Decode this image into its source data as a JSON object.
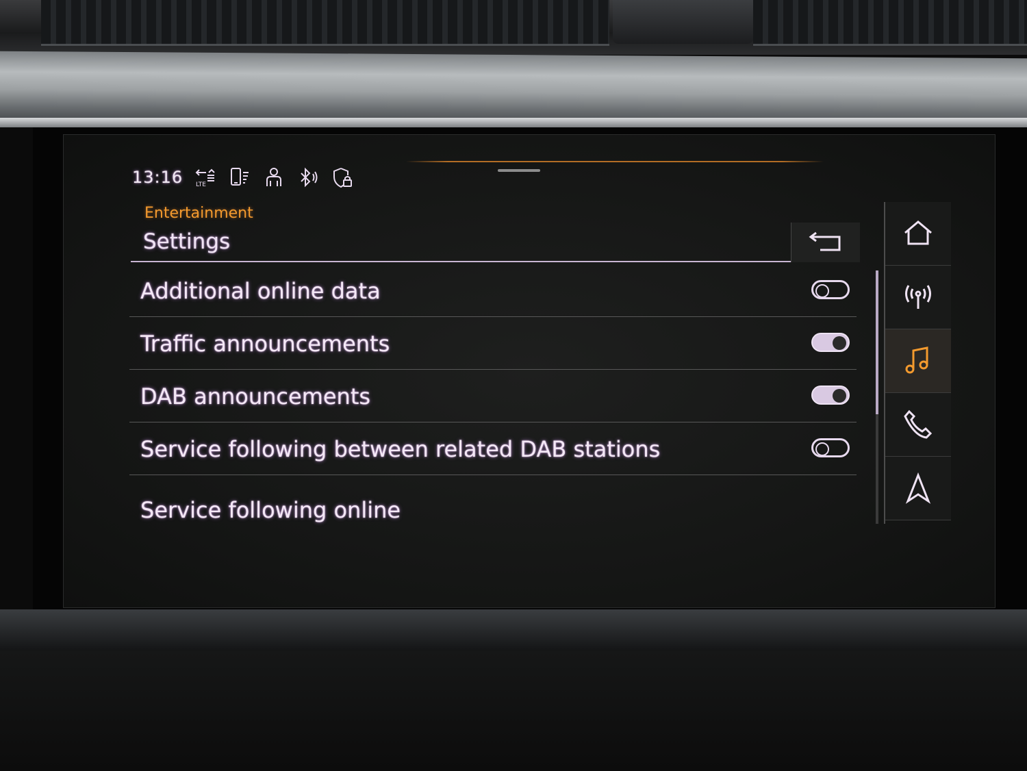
{
  "status_bar": {
    "time": "13:16",
    "icons": [
      "lte-signal-icon",
      "phone-data-icon",
      "user-profile-icon",
      "bluetooth-icon",
      "privacy-shield-icon"
    ]
  },
  "header": {
    "breadcrumb": "Entertainment",
    "title": "Settings",
    "back_icon": "back-arrow-icon"
  },
  "settings": {
    "items": [
      {
        "label": "Additional online data",
        "toggle": "off"
      },
      {
        "label": "Traffic announcements",
        "toggle": "on"
      },
      {
        "label": "DAB announcements",
        "toggle": "on"
      },
      {
        "label": "Service following between related DAB stations",
        "toggle": "off"
      },
      {
        "label": "Service following online"
      }
    ]
  },
  "side_nav": {
    "items": [
      {
        "icon": "home-icon",
        "active": false
      },
      {
        "icon": "radio-antenna-icon",
        "active": false
      },
      {
        "icon": "music-note-icon",
        "active": true
      },
      {
        "icon": "phone-icon",
        "active": false
      },
      {
        "icon": "navigation-arrow-icon",
        "active": false
      }
    ]
  },
  "colors": {
    "accent": "#f39a2e",
    "text": "#f0e4f4"
  }
}
